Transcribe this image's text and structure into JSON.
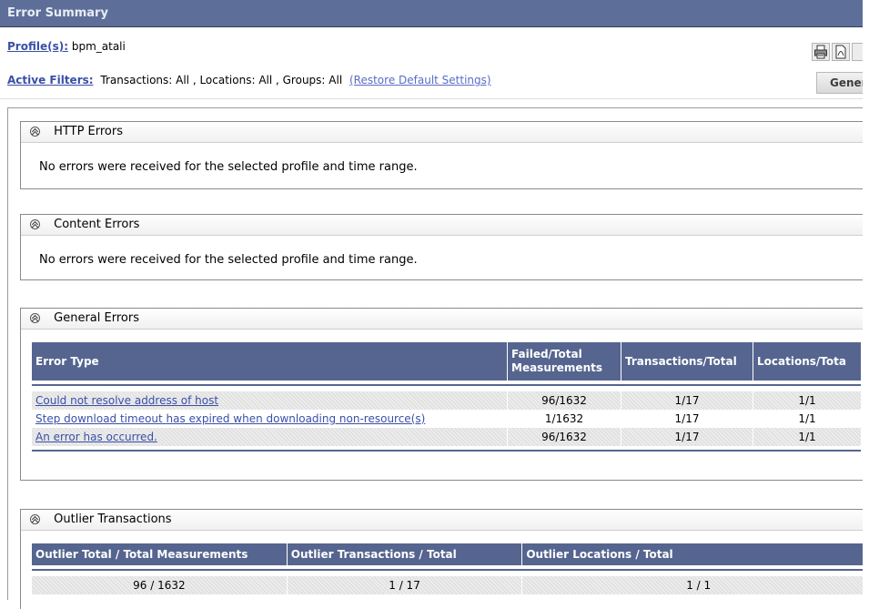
{
  "title": "Error Summary",
  "profile": {
    "label": "Profile(s):",
    "value": "bpm_atali"
  },
  "filters": {
    "label": "Active Filters:",
    "value": "Transactions: All , Locations: All , Groups: All",
    "restore_link": "(Restore Default Settings)"
  },
  "toolbar": {
    "print_icon": "printer-icon",
    "pdf_icon": "pdf-icon",
    "generate_label": "Gener"
  },
  "http_errors": {
    "title": "HTTP Errors",
    "message": "No errors were received for the selected profile and time range."
  },
  "content_errors": {
    "title": "Content Errors",
    "message": "No errors were received for the selected profile and time range."
  },
  "general_errors": {
    "title": "General Errors",
    "columns": [
      "Error Type",
      "Failed/Total Measurements",
      "Transactions/Total",
      "Locations/Tota"
    ],
    "rows": [
      {
        "type": "Could not resolve address of host",
        "failed": "96/1632",
        "transactions": "1/17",
        "locations": "1/1"
      },
      {
        "type": "Step download timeout has expired when downloading non-resource(s)",
        "failed": "1/1632",
        "transactions": "1/17",
        "locations": "1/1"
      },
      {
        "type": "An error has occurred.",
        "failed": "96/1632",
        "transactions": "1/17",
        "locations": "1/1"
      }
    ]
  },
  "outlier_transactions": {
    "title": "Outlier Transactions",
    "columns": [
      "Outlier Total / Total Measurements",
      "Outlier Transactions / Total",
      "Outlier Locations / Total"
    ],
    "rows": [
      {
        "total": "96 / 1632",
        "transactions": "1 / 17",
        "locations": "1 / 1"
      }
    ]
  },
  "colors": {
    "title_bar": "#5d6f99",
    "table_header": "#55658f",
    "link": "#3a4fa8"
  }
}
